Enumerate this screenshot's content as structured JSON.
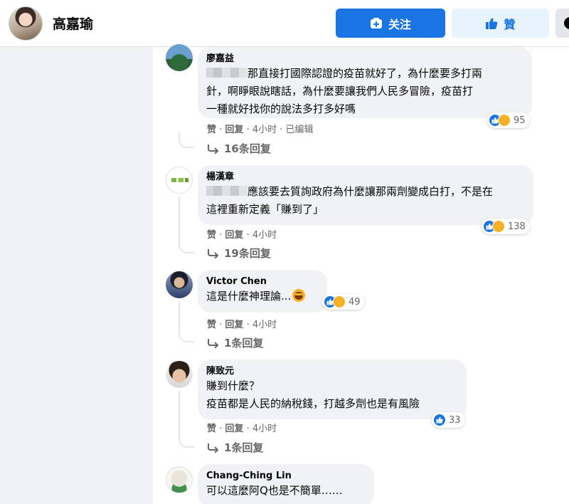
{
  "header": {
    "page_name": "高嘉瑜",
    "follow_label": "关注",
    "like_label": "贊",
    "icons": {
      "follow": "follow-plus-icon",
      "like": "thumbs-up-icon",
      "more": "more-icon"
    }
  },
  "colors": {
    "primary": "#1b74e4",
    "like_bg": "#e7f3ff",
    "bubble": "#f0f2f5",
    "meta": "#65676b",
    "haha": "#f7b125"
  },
  "comments": [
    {
      "author": "廖嘉益",
      "text": "那直接打國際認證的疫苗就好了，為什麼要多打兩針，啊睜眼說瞎話，為什麼要讓我們人民多冒險，疫苗打一種就好找你的說法多打多好嗎",
      "line1": "那直接打國際認證的疫苗就好了，為什麼要多打兩",
      "line2": "針，啊睜眼說瞎話，為什麼要讓我們人民多冒險，疫苗打",
      "line3": "一種就好找你的說法多打多好嗎",
      "like": "赞",
      "reply": "回复",
      "time": "4小时",
      "edited": "已编辑",
      "reaction_count": "95",
      "replies": "16条回复"
    },
    {
      "author": "楊漢章",
      "line1": "應該要去質詢政府為什麼讓那兩劑變成白打，不是在",
      "line2": "這裡重新定義「賺到了」",
      "like": "赞",
      "reply": "回复",
      "time": "4小时",
      "reaction_count": "138",
      "replies": "19条回复"
    },
    {
      "author": "Victor Chen",
      "line1": "這是什麼神理論...",
      "like": "赞",
      "reply": "回复",
      "time": "4小时",
      "reaction_count": "49",
      "replies": "1条回复"
    },
    {
      "author": "陳致元",
      "line1": "賺到什麼？",
      "line2": "疫苗都是人民的納稅錢，打越多劑也是有風險",
      "like": "赞",
      "reply": "回复",
      "time": "4小时",
      "reaction_count": "33",
      "replies": "1条回复"
    },
    {
      "author": "Chang-Ching Lin",
      "line1": "可以這麼阿Q也是不簡單……"
    }
  ],
  "separator": " · "
}
